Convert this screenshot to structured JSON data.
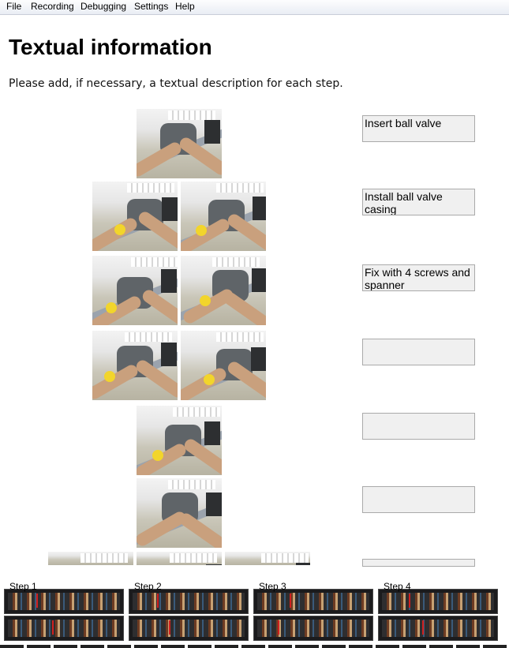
{
  "menu": {
    "items": [
      {
        "label": "File"
      },
      {
        "label": "Recording"
      },
      {
        "label": "Debugging"
      },
      {
        "label": "Settings"
      },
      {
        "label": "Help"
      }
    ]
  },
  "page": {
    "title": "Textual information",
    "subtitle": "Please add, if necessary, a textual description for each step."
  },
  "descriptions": [
    {
      "value": "Insert ball valve",
      "placeholder": ""
    },
    {
      "value": "Install ball valve casing",
      "placeholder": ""
    },
    {
      "value": "Fix with 4 screws and spanner",
      "placeholder": ""
    },
    {
      "value": "",
      "placeholder": ""
    },
    {
      "value": "",
      "placeholder": ""
    },
    {
      "value": "",
      "placeholder": ""
    },
    {
      "value": "",
      "placeholder": ""
    }
  ],
  "steps": [
    {
      "label": "Step 1"
    },
    {
      "label": "Step 2"
    },
    {
      "label": "Step 3"
    },
    {
      "label": "Step 4"
    }
  ]
}
